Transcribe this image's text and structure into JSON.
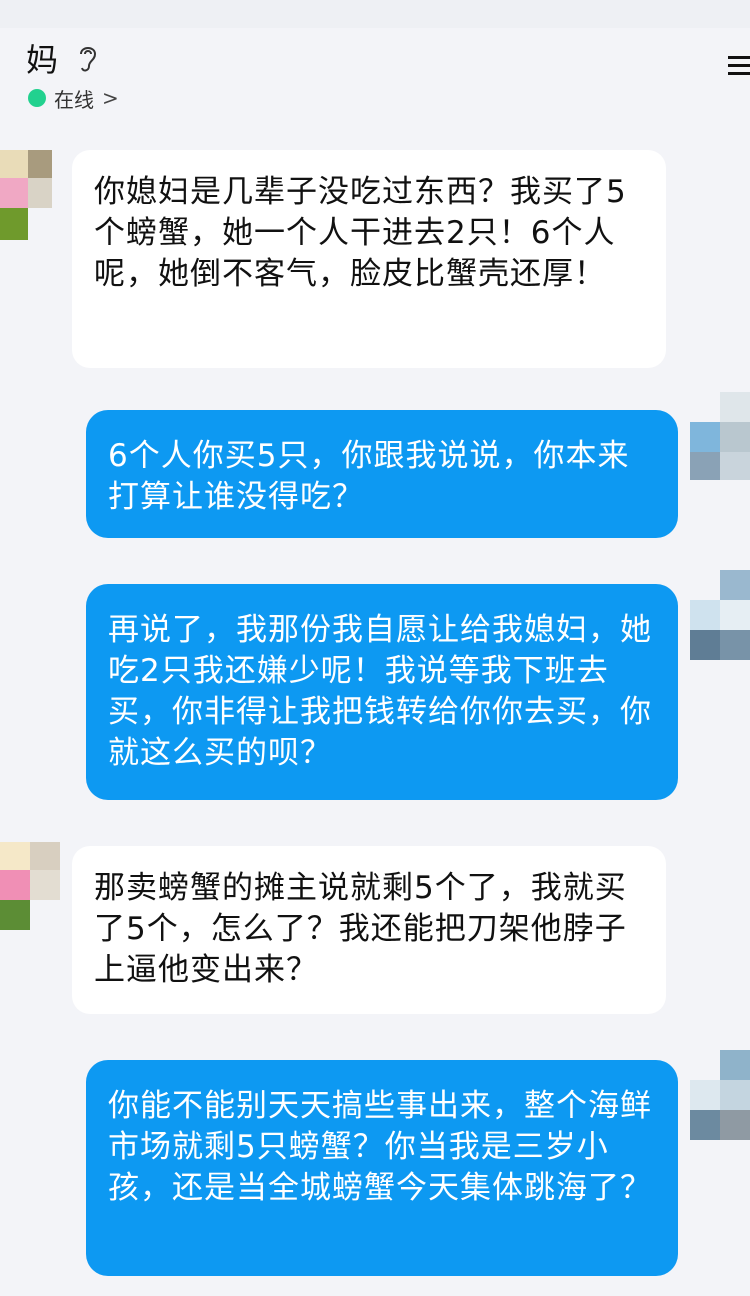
{
  "header": {
    "contact_name": "妈",
    "status": "在线",
    "status_chevron": ">",
    "ear_icon": "ear-icon",
    "menu_icon": "menu-icon",
    "status_color": "#22d18f"
  },
  "messages": [
    {
      "direction": "incoming",
      "text": "你媳妇是几辈子没吃过东西？我买了5个螃蟹，她一个人干进去2只！6个人呢，她倒不客气，脸皮比蟹壳还厚！"
    },
    {
      "direction": "outgoing",
      "text": " 6个人你买5只，你跟我说说，你本来打算让谁没得吃？"
    },
    {
      "direction": "outgoing",
      "text": "再说了，我那份我自愿让给我媳妇，她吃2只我还嫌少呢！我说等我下班去买，你非得让我把钱转给你你去买，你就这么买的呗？"
    },
    {
      "direction": "incoming",
      "text": "那卖螃蟹的摊主说就剩5个了，我就买了5个，怎么了？我还能把刀架他脖子上逼他变出来？"
    },
    {
      "direction": "outgoing",
      "text": "你能不能别天天搞些事出来，整个海鲜市场就剩5只螃蟹？你当我是三岁小孩，还是当全城螃蟹今天集体跳海了？"
    }
  ],
  "colors": {
    "outgoing_bubble": "#0d99f2",
    "incoming_bubble": "#ffffff",
    "background": "#f3f4f8"
  }
}
